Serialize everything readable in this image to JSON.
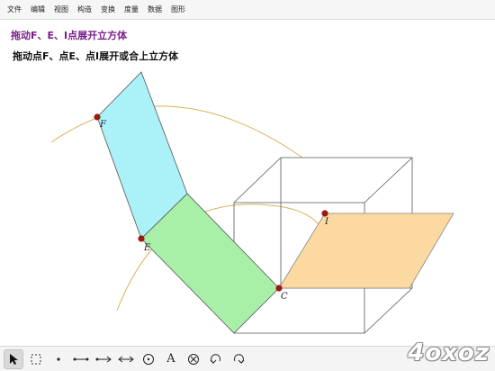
{
  "menubar": {
    "items": [
      "文件",
      "编辑",
      "视图",
      "构造",
      "变换",
      "度量",
      "数据",
      "图形"
    ]
  },
  "canvas": {
    "title": "拖动F、E、I点展开立方体",
    "action_button": "拖动点F、点E、点I展开或合上立方体",
    "points": {
      "F": "F",
      "E": "E",
      "I": "I",
      "C": "C"
    },
    "colors": {
      "face_cyan": "#aaf2f8",
      "face_green": "#a8f0a8",
      "face_orange": "#fbd9a0",
      "arc": "#d8b25a",
      "point": "#9a1a12",
      "cube_edge": "#555555",
      "title": "#7a1f8a"
    }
  },
  "toolbar": {
    "tools": [
      {
        "name": "select-arrow-icon",
        "active": true
      },
      {
        "name": "marquee-select-icon"
      },
      {
        "name": "point-tool-icon"
      },
      {
        "name": "segment-tool-icon"
      },
      {
        "name": "ray-tool-icon"
      },
      {
        "name": "line-tool-icon"
      },
      {
        "name": "circle-tool-icon"
      },
      {
        "name": "text-tool-icon",
        "glyph": "A"
      },
      {
        "name": "marker-tool-icon"
      },
      {
        "name": "undo-icon"
      },
      {
        "name": "redo-icon"
      }
    ]
  },
  "watermark": {
    "text": "4oxoz"
  }
}
